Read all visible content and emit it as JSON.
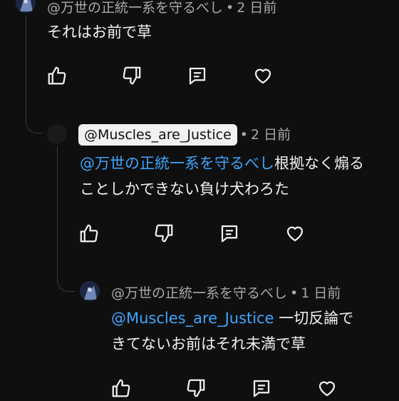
{
  "comments": [
    {
      "author": "@万世の正統一系を守るべし",
      "time": "2 日前",
      "text_parts": [
        {
          "text": "それはお前で草",
          "mention": false
        }
      ]
    },
    {
      "author": "@Muscles_are_Justice",
      "time": "2 日前",
      "text_parts": [
        {
          "text": "@万世の正統一系を守るべし",
          "mention": true
        },
        {
          "text": "根拠なく煽る",
          "mention": false
        },
        {
          "text": "ことしかできない負け犬わろた",
          "mention": false
        }
      ]
    },
    {
      "author": "@万世の正統一系を守るべし",
      "time": "1 日前",
      "text_parts": [
        {
          "text": "@Muscles_are_Justice",
          "mention": true
        },
        {
          "text": " 一切反論で",
          "mention": false
        },
        {
          "text": "きてないお前はそれ未満で草",
          "mention": false
        }
      ]
    }
  ],
  "separator": "•",
  "icons": [
    "thumbs-up-icon",
    "thumbs-down-icon",
    "reply-icon",
    "heart-icon"
  ],
  "colors": {
    "background": "#0f0f0f",
    "text": "#f1f1f1",
    "meta": "#aaaaaa",
    "mention": "#3ea6ff",
    "thread": "#3a3a3a"
  }
}
